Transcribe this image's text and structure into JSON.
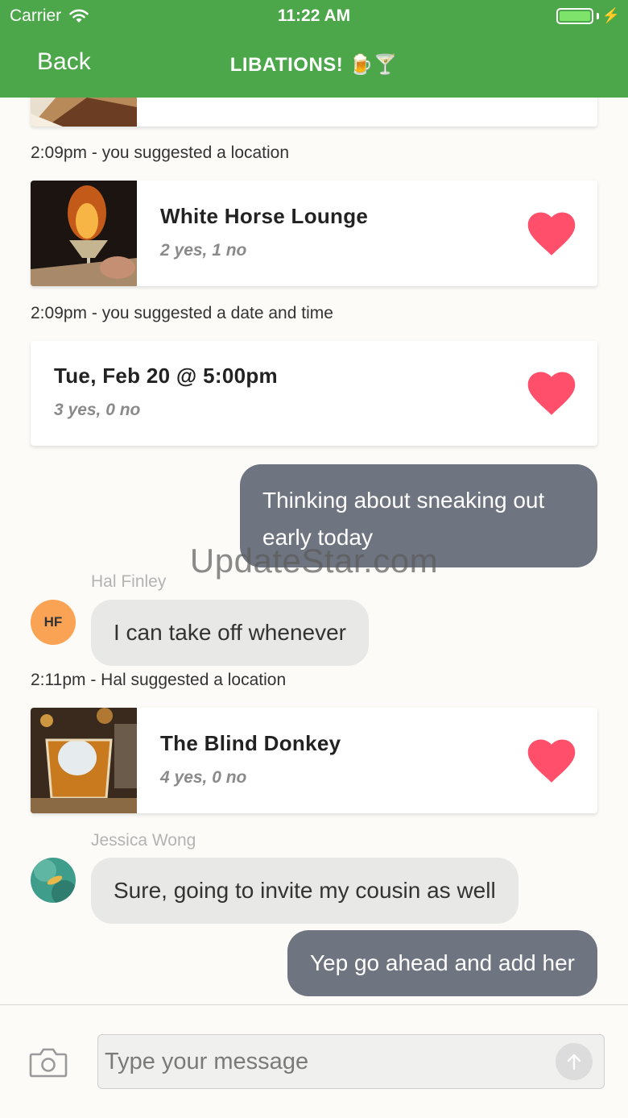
{
  "status_bar": {
    "carrier": "Carrier",
    "time": "11:22 AM"
  },
  "nav": {
    "back_label": "Back",
    "title": "LIBATIONS! 🍺🍸"
  },
  "feed": {
    "stamp_1": "2:09pm - you suggested a location",
    "card_location_1": {
      "title": "White Horse Lounge",
      "votes": "2 yes, 1 no"
    },
    "stamp_2": "2:09pm - you suggested a date and time",
    "card_date": {
      "title": "Tue, Feb 20 @ 5:00pm",
      "votes": "3 yes, 0 no"
    },
    "msg_out_1": "Thinking about sneaking out early today",
    "hal": {
      "name": "Hal Finley",
      "initials": "HF",
      "message": "I can take off whenever"
    },
    "stamp_3": "2:11pm - Hal suggested a location",
    "card_location_2": {
      "title": "The Blind Donkey",
      "votes": "4 yes, 0 no"
    },
    "jessica": {
      "name": "Jessica Wong",
      "message": "Sure, going to invite my cousin as well"
    },
    "msg_out_2": "Yep go ahead and add her"
  },
  "watermark": "UpdateStar.com",
  "composer": {
    "placeholder": "Type your message"
  },
  "colors": {
    "header": "#4ca74a",
    "heart": "#ff4f6b",
    "outgoing_bubble": "#6f7580",
    "incoming_bubble": "#e8e8e6"
  },
  "icons": [
    "wifi-icon",
    "battery-icon",
    "heart-icon",
    "camera-icon",
    "send-arrow-icon"
  ]
}
